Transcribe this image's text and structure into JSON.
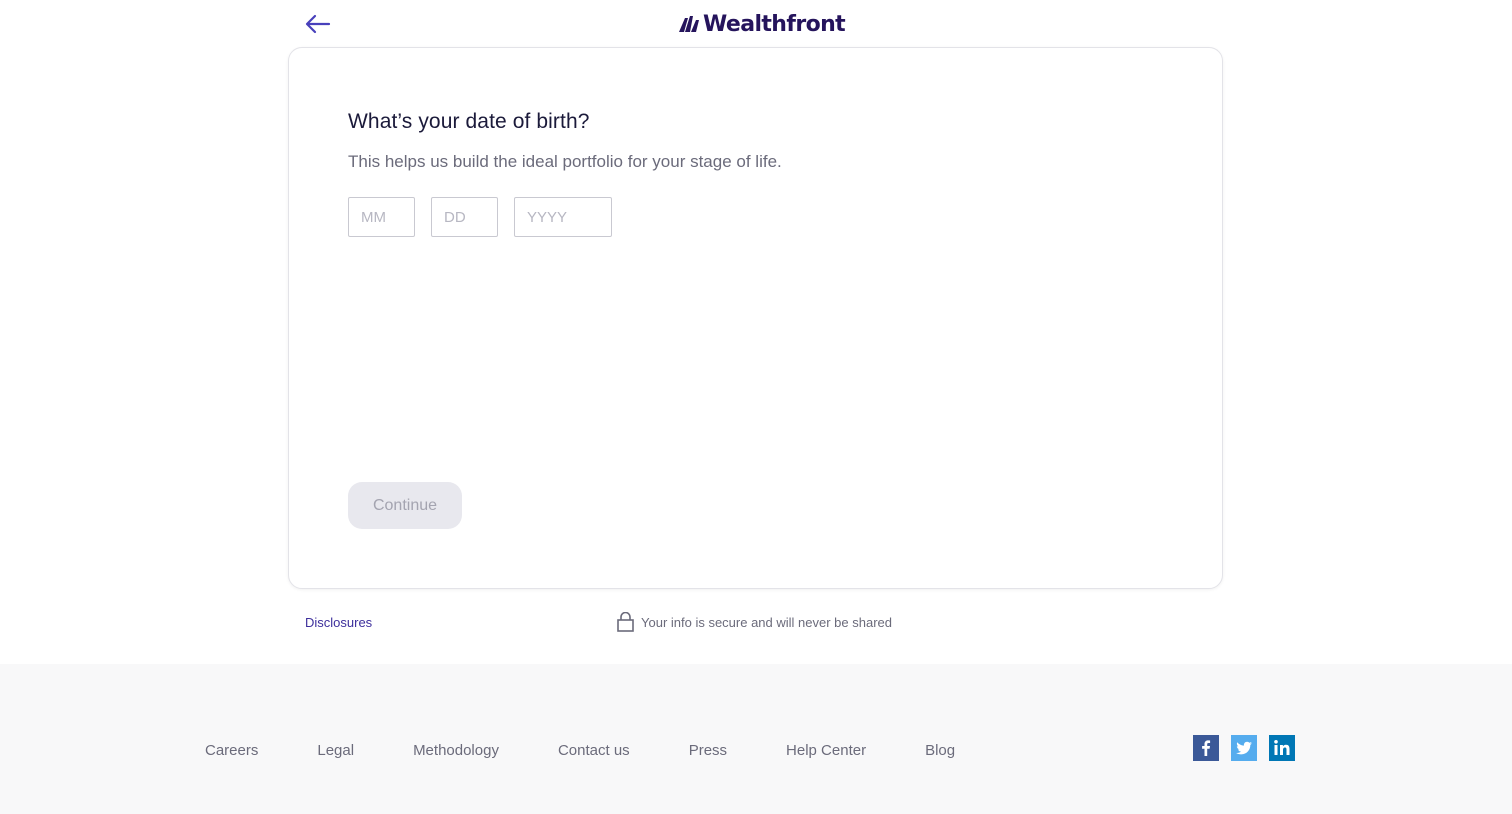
{
  "header": {
    "back_icon": "arrow-left-icon",
    "logo_text": "Wealthfront",
    "logo_icon": "wealthfront-mark-icon"
  },
  "card": {
    "title": "What’s your date of birth?",
    "subtitle": "This helps us build the ideal portfolio for your stage of life.",
    "fields": {
      "month": {
        "value": "",
        "placeholder": "MM"
      },
      "day": {
        "value": "",
        "placeholder": "DD"
      },
      "year": {
        "value": "",
        "placeholder": "YYYY"
      }
    },
    "continue_label": "Continue"
  },
  "below_card": {
    "disclosures_label": "Disclosures",
    "secure_icon": "lock-icon",
    "secure_text": "Your info is secure and will never be shared"
  },
  "footer": {
    "links": [
      "Careers",
      "Legal",
      "Methodology",
      "Contact us",
      "Press",
      "Help Center",
      "Blog"
    ],
    "social": [
      {
        "name": "facebook-icon",
        "color": "#3b5998"
      },
      {
        "name": "twitter-icon",
        "color": "#55acee"
      },
      {
        "name": "linkedin-icon",
        "color": "#0077b5"
      }
    ]
  },
  "colors": {
    "brand": "#25145c",
    "accent": "#4840bb",
    "link": "#3d2f9c",
    "muted_text": "#6b6b7b",
    "disabled_button_bg": "#e8e8ee",
    "footer_bg": "#f8f8f9"
  }
}
